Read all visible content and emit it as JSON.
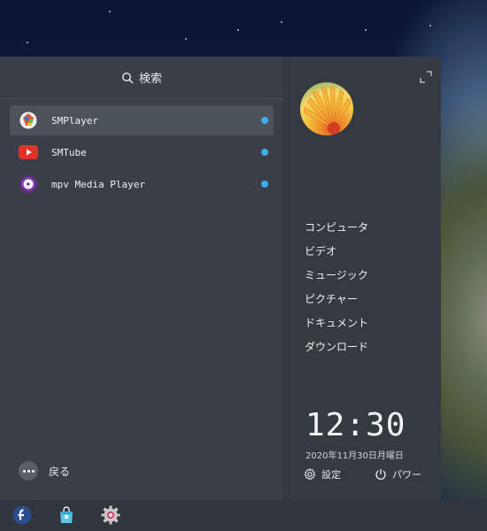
{
  "search": {
    "label": "検索"
  },
  "apps": [
    {
      "label": "SMPlayer",
      "icon": "smplayer-icon",
      "selected": true,
      "new": true
    },
    {
      "label": "SMTube",
      "icon": "smtube-icon",
      "selected": false,
      "new": true
    },
    {
      "label": "mpv Media Player",
      "icon": "mpv-icon",
      "selected": false,
      "new": true
    }
  ],
  "back": {
    "label": "戻る"
  },
  "places": [
    {
      "label": "コンピュータ"
    },
    {
      "label": "ビデオ"
    },
    {
      "label": "ミュージック"
    },
    {
      "label": "ピクチャー"
    },
    {
      "label": "ドキュメント"
    },
    {
      "label": "ダウンロード"
    }
  ],
  "clock": {
    "time": "12:30",
    "date": "2020年11月30日月曜日"
  },
  "actions": {
    "settings_label": "設定",
    "power_label": "パワー"
  },
  "taskbar": {
    "items": [
      "fedora-icon",
      "store-icon",
      "settings-gear-icon"
    ]
  },
  "colors": {
    "accent": "#3daee9",
    "panel": "#3a3f47",
    "taskbar": "#31363c"
  }
}
